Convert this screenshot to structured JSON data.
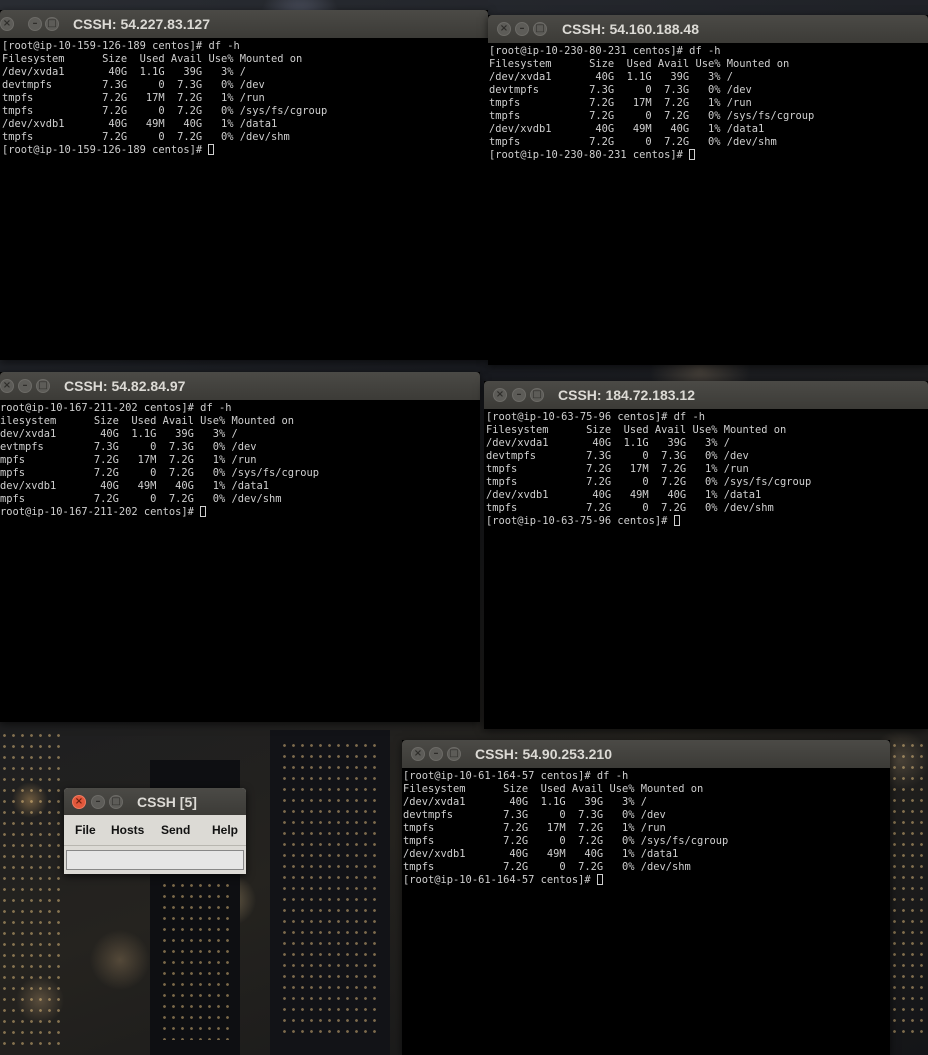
{
  "terminal_lines": {
    "prompt_cmd_suffix": " centos]# df -h",
    "header": "Filesystem      Size  Used Avail Use% Mounted on",
    "rows": [
      "/dev/xvda1       40G  1.1G   39G   3% /",
      "devtmpfs        7.3G     0  7.3G   0% /dev",
      "tmpfs           7.2G   17M  7.2G   1% /run",
      "tmpfs           7.2G     0  7.2G   0% /sys/fs/cgroup",
      "/dev/xvdb1       40G   49M   40G   1% /data1",
      "tmpfs           7.2G     0  7.2G   0% /dev/shm"
    ]
  },
  "terminals": [
    {
      "title": "CSSH: 54.227.83.127",
      "cmd_line": "[root@ip-10-159-126-189 centos]# df -h",
      "prompt_line": "[root@ip-10-159-126-189 centos]# "
    },
    {
      "title": "CSSH: 54.160.188.48",
      "cmd_line": "[root@ip-10-230-80-231 centos]# df -h",
      "prompt_line": "[root@ip-10-230-80-231 centos]# "
    },
    {
      "title": "CSSH: 54.82.84.97",
      "cmd_line": "root@ip-10-167-211-202 centos]# df -h",
      "prompt_line": "root@ip-10-167-211-202 centos]# ",
      "header": "ilesystem      Size  Used Avail Use% Mounted on",
      "rows": [
        "dev/xvda1       40G  1.1G   39G   3% /",
        "evtmpfs        7.3G     0  7.3G   0% /dev",
        "mpfs           7.2G   17M  7.2G   1% /run",
        "mpfs           7.2G     0  7.2G   0% /sys/fs/cgroup",
        "dev/xvdb1       40G   49M   40G   1% /data1",
        "mpfs           7.2G     0  7.2G   0% /dev/shm"
      ]
    },
    {
      "title": "CSSH: 184.72.183.12",
      "cmd_line": "[root@ip-10-63-75-96 centos]# df -h",
      "prompt_line": "[root@ip-10-63-75-96 centos]# "
    },
    {
      "title": "CSSH: 54.90.253.210",
      "cmd_line": "[root@ip-10-61-164-57 centos]# df -h",
      "prompt_line": "[root@ip-10-61-164-57 centos]# "
    }
  ],
  "cssh_console": {
    "title": "CSSH [5]",
    "menu": [
      "File",
      "Hosts",
      "Send",
      "Help"
    ],
    "input_value": ""
  }
}
